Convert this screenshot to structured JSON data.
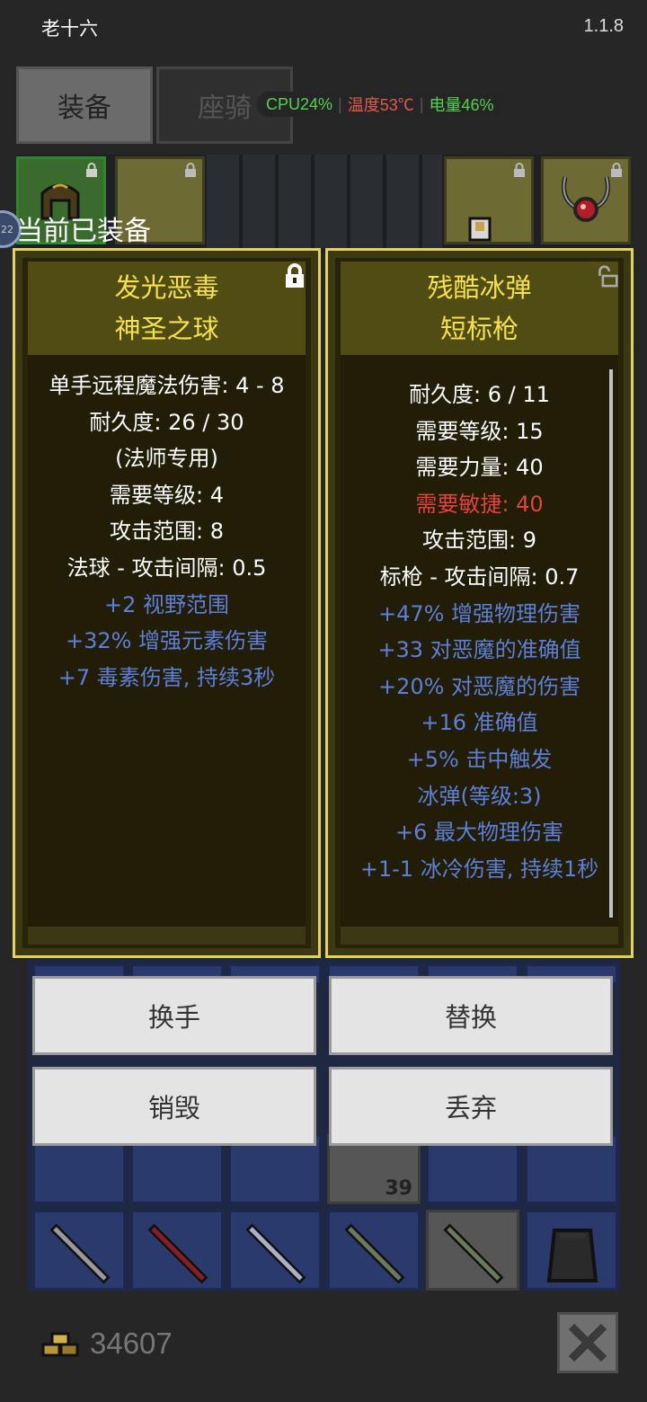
{
  "status_bar": {
    "carrier": "老十六",
    "version": "1.1.8"
  },
  "tabs": [
    {
      "label": "装备"
    },
    {
      "label": "座骑"
    }
  ],
  "perf": {
    "cpu": "CPU24%",
    "temp": "温度53℃",
    "battery": "电量46%"
  },
  "equipped_label": "当前已装备",
  "level_badge": "22",
  "left_item": {
    "name_line1": "发光恶毒",
    "name_line2": "神圣之球",
    "stats": [
      {
        "text": "单手远程魔法伤害: 4 - 8",
        "style": "white"
      },
      {
        "text": "耐久度: 26 / 30",
        "style": "white"
      },
      {
        "text": "(法师专用)",
        "style": "white"
      },
      {
        "text": "需要等级: 4",
        "style": "white"
      },
      {
        "text": "攻击范围: 8",
        "style": "white"
      },
      {
        "text": "法球 - 攻击间隔: 0.5",
        "style": "white"
      },
      {
        "text": "+2 视野范围",
        "style": "blue"
      },
      {
        "text": "+32% 增强元素伤害",
        "style": "blue"
      },
      {
        "text": "+7 毒素伤害, 持续3秒",
        "style": "blue"
      }
    ]
  },
  "right_item": {
    "name_line1": "残酷冰弹",
    "name_line2": "短标枪",
    "stats": [
      {
        "text": "耐久度: 6 / 11",
        "style": "white"
      },
      {
        "text": "需要等级: 15",
        "style": "white"
      },
      {
        "text": "需要力量: 40",
        "style": "white"
      },
      {
        "text": "需要敏捷: 40",
        "style": "red"
      },
      {
        "text": "攻击范围: 9",
        "style": "white"
      },
      {
        "text": "标枪 - 攻击间隔: 0.7",
        "style": "white"
      },
      {
        "text": "+47% 增强物理伤害",
        "style": "blue"
      },
      {
        "text": "+33 对恶魔的准确值",
        "style": "blue"
      },
      {
        "text": "+20% 对恶魔的伤害",
        "style": "blue"
      },
      {
        "text": "+16 准确值",
        "style": "blue"
      },
      {
        "text": "+5% 击中触发",
        "style": "blue"
      },
      {
        "text": "冰弹(等级:3)",
        "style": "blue"
      },
      {
        "text": "+6 最大物理伤害",
        "style": "blue"
      },
      {
        "text": "+1-1 冰冷伤害, 持续1秒",
        "style": "blue"
      }
    ]
  },
  "actions": {
    "swap_hand": "换手",
    "replace": "替换",
    "destroy": "销毁",
    "discard": "丢弃"
  },
  "inventory": {
    "stack_count": "39"
  },
  "gold": "34607",
  "colors": {
    "title_yellow": "#f4e24a",
    "magic_blue": "#5e7fd8",
    "unmet_red": "#e3433a",
    "card_border": "#e3d35a"
  },
  "icons": [
    "lock-icon",
    "unlock-icon",
    "gold-coins-icon",
    "close-icon"
  ]
}
